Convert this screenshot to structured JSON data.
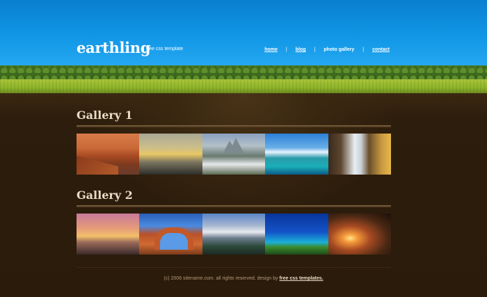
{
  "header": {
    "logo": "earthling",
    "tagline": "free css template"
  },
  "nav": {
    "items": [
      {
        "label": "home",
        "underlined": true
      },
      {
        "label": "blog",
        "underlined": true
      },
      {
        "label": "photo gallery",
        "underlined": false
      },
      {
        "label": "contact",
        "underlined": true
      }
    ]
  },
  "galleries": [
    {
      "title": "Gallery 1",
      "thumbnails": [
        "sea-cliffs-photo",
        "sunset-clouds-photo",
        "mountain-waterfall-photo",
        "tropical-lagoon-photo",
        "canyon-waterfall-photo"
      ]
    },
    {
      "title": "Gallery 2",
      "thumbnails": [
        "beach-sunset-photo",
        "rock-arch-photo",
        "mountain-valley-photo",
        "palm-beach-photo",
        "desert-sunrise-photo"
      ]
    }
  ],
  "footer": {
    "copyright": "(c) 2006 sitename.com. all rights reserved. design by ",
    "credit_link": "free css templates."
  }
}
